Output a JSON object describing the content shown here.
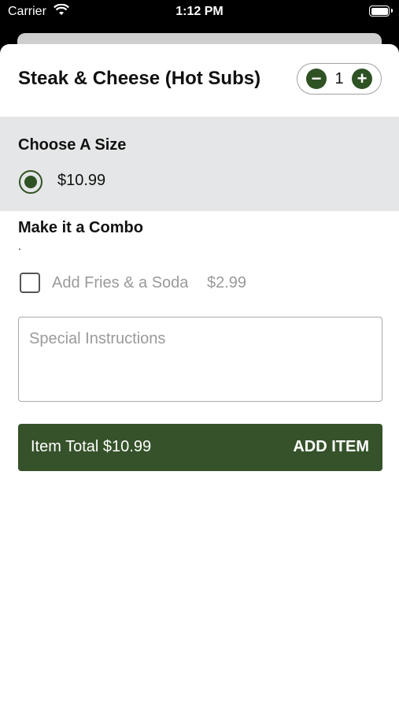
{
  "status_bar": {
    "carrier": "Carrier",
    "time": "1:12 PM",
    "icons": [
      "wifi-icon",
      "battery-icon"
    ]
  },
  "item": {
    "title": "Steak & Cheese (Hot Subs)",
    "quantity": "1",
    "minus": "−",
    "plus": "+"
  },
  "size_section": {
    "heading": "Choose A Size",
    "options": [
      {
        "price": "$10.99",
        "selected": true
      }
    ]
  },
  "combo_section": {
    "heading": "Make it a Combo",
    "note": ".",
    "option": {
      "label": "Add Fries & a Soda",
      "price": "$2.99",
      "checked": false
    }
  },
  "instructions": {
    "placeholder": "Special Instructions",
    "value": ""
  },
  "add_bar": {
    "total_label": "Item Total $10.99",
    "action_label": "ADD ITEM"
  },
  "colors": {
    "accent": "#2f5224",
    "button": "#35522a",
    "section_bg": "#e5e6e7"
  }
}
